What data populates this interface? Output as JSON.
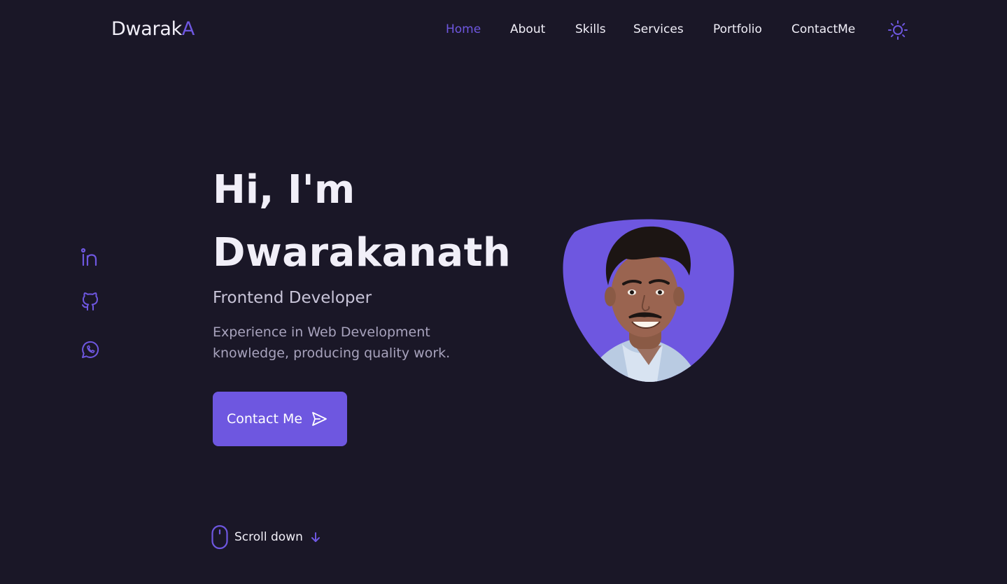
{
  "header": {
    "logo_main": "Dwarak",
    "logo_accent": "A",
    "nav": [
      {
        "label": "Home",
        "active": true
      },
      {
        "label": "About",
        "active": false
      },
      {
        "label": "Skills",
        "active": false
      },
      {
        "label": "Services",
        "active": false
      },
      {
        "label": "Portfolio",
        "active": false
      },
      {
        "label": "ContactMe",
        "active": false
      }
    ],
    "theme_icon": "sun-icon"
  },
  "social": [
    {
      "icon": "linkedin-icon"
    },
    {
      "icon": "github-icon"
    },
    {
      "icon": "whatsapp-icon"
    }
  ],
  "hero": {
    "greeting": "Hi, I'm",
    "name": "Dwarakanath",
    "role": "Frontend Developer",
    "description": "Experience in Web Development knowledge, producing quality work.",
    "button_label": "Contact Me",
    "button_icon": "send-icon"
  },
  "scroll": {
    "label": "Scroll down",
    "icon": "mouse-icon",
    "arrow_icon": "arrow-down-icon"
  },
  "colors": {
    "background": "#1a1727",
    "accent": "#6e57e0",
    "text": "#f1eff8",
    "muted": "#a8a3bd"
  }
}
